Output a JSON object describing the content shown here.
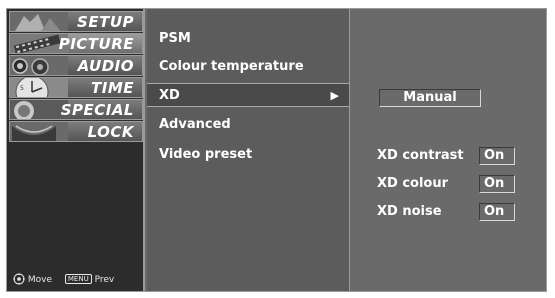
{
  "sidebar": {
    "categories": [
      {
        "label": "SETUP",
        "icon": "setup-thumbnail-icon"
      },
      {
        "label": "PICTURE",
        "icon": "picture-thumbnail-icon"
      },
      {
        "label": "AUDIO",
        "icon": "audio-thumbnail-icon"
      },
      {
        "label": "TIME",
        "icon": "time-thumbnail-icon"
      },
      {
        "label": "SPECIAL",
        "icon": "special-thumbnail-icon"
      },
      {
        "label": "LOCK",
        "icon": "lock-thumbnail-icon"
      }
    ],
    "active_index": 1,
    "footer": {
      "move_label": "Move",
      "menu_key": "MENU",
      "prev_label": "Prev"
    }
  },
  "menu": {
    "items": [
      {
        "label": "PSM"
      },
      {
        "label": "Colour temperature"
      },
      {
        "label": "XD",
        "arrow": "▶"
      },
      {
        "label": "Advanced"
      },
      {
        "label": "Video preset"
      }
    ],
    "selected_index": 2
  },
  "xd_panel": {
    "mode": "Manual",
    "options": [
      {
        "label": "XD contrast",
        "value": "On"
      },
      {
        "label": "XD colour",
        "value": "On"
      },
      {
        "label": "XD noise",
        "value": "On"
      }
    ]
  },
  "colors": {
    "panel_bg": "#6a6a6a",
    "sidebar_bg": "#2c2c2c",
    "text": "#ffffff"
  }
}
